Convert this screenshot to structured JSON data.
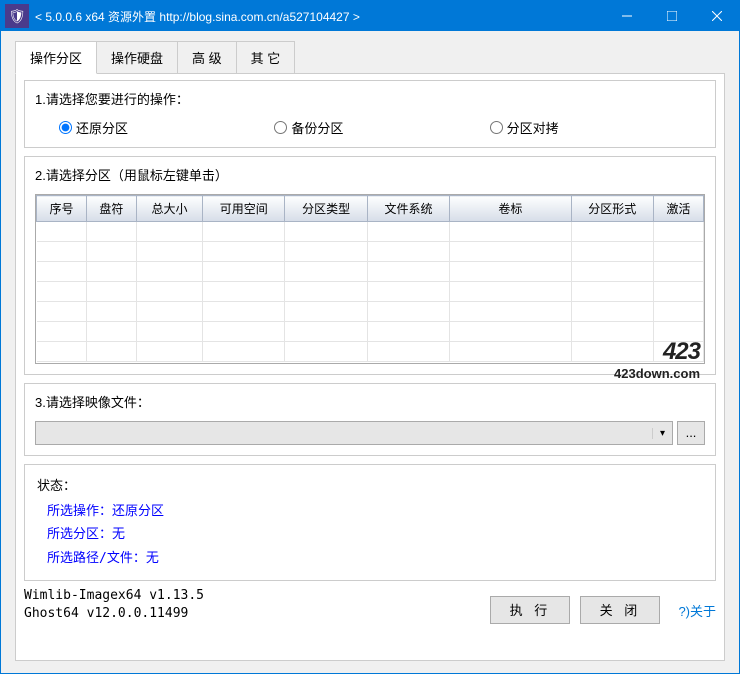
{
  "titlebar": {
    "text": "< 5.0.0.6 x64 资源外置 http://blog.sina.com.cn/a527104427 >"
  },
  "tabs": [
    {
      "label": "操作分区"
    },
    {
      "label": "操作硬盘"
    },
    {
      "label": "高 级"
    },
    {
      "label": "其 它"
    }
  ],
  "section1": {
    "title": "1.请选择您要进行的操作：",
    "radios": [
      {
        "label": "还原分区",
        "checked": true
      },
      {
        "label": "备份分区",
        "checked": false
      },
      {
        "label": "分区对拷",
        "checked": false
      }
    ]
  },
  "section2": {
    "title": "2.请选择分区（用鼠标左键单击）",
    "columns": [
      "序号",
      "盘符",
      "总大小",
      "可用空间",
      "分区类型",
      "文件系统",
      "卷标",
      "分区形式",
      "激活"
    ]
  },
  "section3": {
    "title": "3.请选择映像文件：",
    "combo_value": "",
    "browse_label": "..."
  },
  "status": {
    "title": "状态：",
    "lines": [
      "所选操作：还原分区",
      "所选分区：无",
      "所选路径/文件：无"
    ]
  },
  "footer": {
    "version1": "Wimlib-Imagex64 v1.13.5",
    "version2": "Ghost64 v12.0.0.11499",
    "execute": "执 行",
    "close": "关 闭",
    "about": "?)关于"
  },
  "watermark": {
    "big": "423",
    "small": "423down.com"
  }
}
